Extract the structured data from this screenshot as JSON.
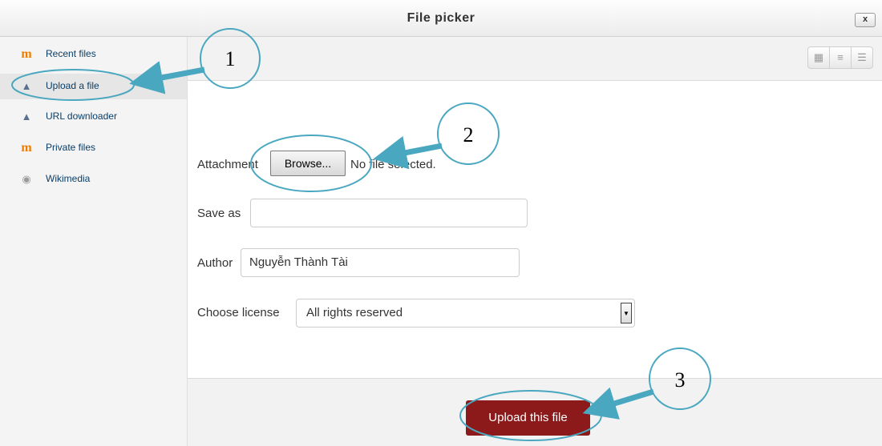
{
  "dialog": {
    "title": "File picker",
    "close_label": "x"
  },
  "sidebar": {
    "items": [
      {
        "label": "Recent files",
        "icon": "moodle-icon",
        "active": false
      },
      {
        "label": "Upload a file",
        "icon": "upload-icon",
        "active": true
      },
      {
        "label": "URL downloader",
        "icon": "upload-icon",
        "active": false
      },
      {
        "label": "Private files",
        "icon": "moodle-icon",
        "active": false
      },
      {
        "label": "Wikimedia",
        "icon": "wikimedia-icon",
        "active": false
      }
    ]
  },
  "toolbar": {
    "view_icons": [
      "icons-view-icon",
      "list-view-icon",
      "tree-view-icon"
    ]
  },
  "form": {
    "attachment_label": "Attachment",
    "browse_label": "Browse...",
    "no_file_text": "No file selected.",
    "save_as_label": "Save as",
    "save_as_value": "",
    "author_label": "Author",
    "author_value": "Nguyễn Thành Tài",
    "license_label": "Choose license",
    "license_value": "All rights reserved"
  },
  "footer": {
    "upload_label": "Upload this file"
  },
  "annotations": {
    "step1": "1",
    "step2": "2",
    "step3": "3"
  },
  "colors": {
    "upload_button": "#8c1a1a",
    "annotation": "#4aa7c0",
    "link": "#0a3d66"
  }
}
